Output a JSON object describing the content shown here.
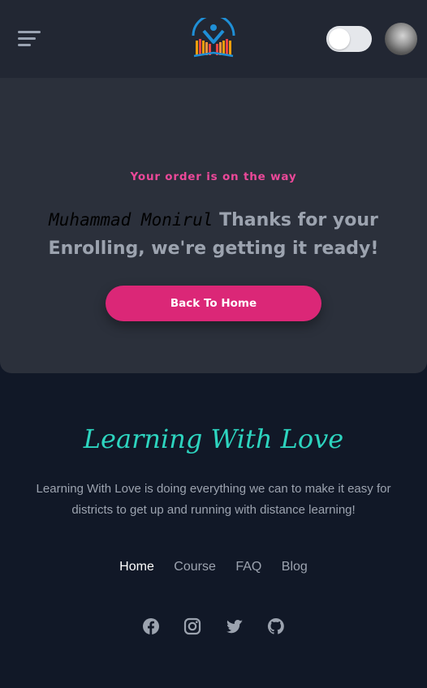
{
  "header": {
    "menu_icon": "hamburger-menu-icon",
    "logo_icon": "book-graduate-logo",
    "theme_toggle_state": "off",
    "avatar_icon": "user-avatar"
  },
  "hero": {
    "subtitle": "Your order is on the way",
    "user_name": "Muhammad Monirul",
    "message": "Thanks for your Enrolling, we're getting it ready!",
    "button_label": "Back To Home"
  },
  "footer": {
    "brand": "Learning With Love",
    "description": "Learning With Love is doing everything we can to make it easy for districts to get up and running with distance learning!",
    "nav": [
      {
        "label": "Home"
      },
      {
        "label": "Course"
      },
      {
        "label": "FAQ"
      },
      {
        "label": "Blog"
      }
    ],
    "social_icons": [
      "facebook-icon",
      "instagram-icon",
      "twitter-icon",
      "github-icon"
    ]
  },
  "colors": {
    "header_bg": "#222733",
    "hero_bg": "#2b303b",
    "footer_bg": "#111827",
    "accent_pink": "#db2777",
    "brand_teal": "#2dd4bf"
  }
}
